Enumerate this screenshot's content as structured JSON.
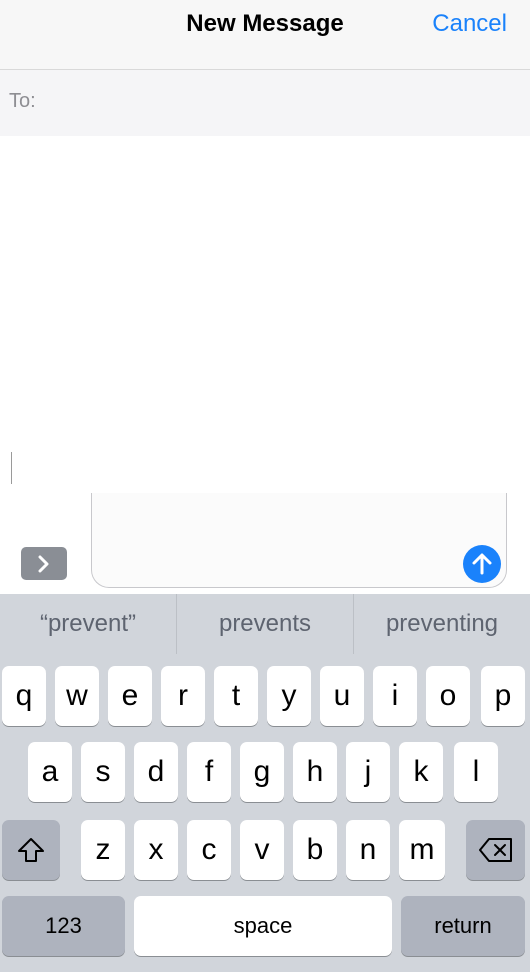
{
  "nav": {
    "title": "New Message",
    "cancel_label": "Cancel"
  },
  "to_field": {
    "label": "To:"
  },
  "suggestions": [
    "“prevent”",
    "prevents",
    "preventing"
  ],
  "keyboard": {
    "row1": [
      "q",
      "w",
      "e",
      "r",
      "t",
      "y",
      "u",
      "i",
      "o",
      "p"
    ],
    "row2": [
      "a",
      "s",
      "d",
      "f",
      "g",
      "h",
      "j",
      "k",
      "l"
    ],
    "row3": [
      "z",
      "x",
      "c",
      "v",
      "b",
      "n",
      "m"
    ],
    "numbers_label": "123",
    "space_label": "space",
    "return_label": "return"
  },
  "icons": {
    "expand": "chevron-right-icon",
    "send": "arrow-up-icon",
    "shift": "shift-icon",
    "backspace": "backspace-icon"
  },
  "colors": {
    "accent": "#1a82fb",
    "keyboard_bg": "#d1d5db",
    "key_dark": "#aeb3be"
  }
}
